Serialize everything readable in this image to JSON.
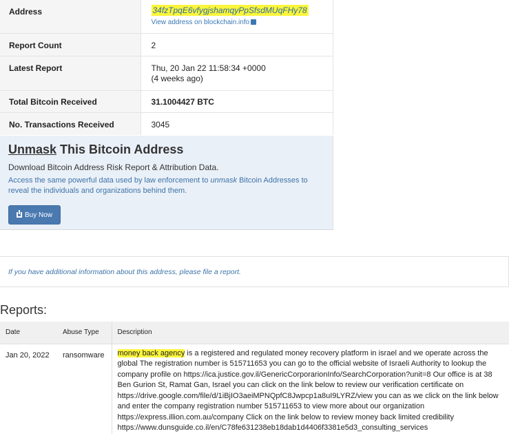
{
  "info": {
    "address_label": "Address",
    "address_value": "34fzTpqE6vfygjshamqyPpSfsdMUqFHy78",
    "address_link": "View address on blockchain.info",
    "report_count_label": "Report Count",
    "report_count_value": "2",
    "latest_report_label": "Latest Report",
    "latest_report_value": "Thu, 20 Jan 22 11:58:34 +0000",
    "latest_report_ago": "(4 weeks ago)",
    "total_received_label": "Total Bitcoin Received",
    "total_received_value": "31.1004427 BTC",
    "tx_received_label": "No. Transactions Received",
    "tx_received_value": "3045"
  },
  "promo": {
    "title_underlined": "Unmask",
    "title_rest": " This Bitcoin Address",
    "subtitle": "Download Bitcoin Address Risk Report & Attribution Data.",
    "desc_part1": "Access the same powerful data used by law enforcement to ",
    "desc_italic": "unmask",
    "desc_part2": " Bitcoin Addresses to reveal the individuals and organizations behind them.",
    "buy_label": "Buy Now"
  },
  "note": {
    "text_before": "If you have additional information about this address, please ",
    "link": "file a report",
    "text_after": "."
  },
  "reports": {
    "title": "Reports:",
    "columns": [
      "Date",
      "Abuse Type",
      "Description"
    ],
    "rows": [
      {
        "date": "Jan 20, 2022",
        "abuse_type": "ransomware",
        "desc_highlight": "money back agency",
        "desc_rest": " is a registered and regulated money recovery platform in israel and we operate across the global The registration number is 515711653 you can go to the official website of Israeli Authority to lookup the company profile on https://ica.justice.gov.il/GenericCorporarionInfo/SearchCorporation?unit=8 Our office is at 38 Ben Gurion St, Ramat Gan, Israel you can click on the link below to review our verification certificate on https://drive.google.com/file/d/1iBjIO3aeiMPNQpfC8Jwpcp1a8uI9LYRZ/view you can as we click on the link below and enter the company registration number 515711653 to view more about our organization https://express.illion.com.au/company Click on the link below to review money back limited credibility https://www.dunsguide.co.il/en/C78fe631238eb18dab1d4406f3381e5d3_consulting_services"
      }
    ]
  }
}
